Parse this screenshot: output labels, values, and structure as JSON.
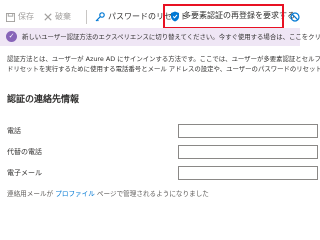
{
  "toolbar": {
    "save_label": "保存",
    "discard_label": "破棄",
    "password_reset_label": "パスワードのリセット",
    "require_mfa_reregister_label": "多要素認証の再登録を要求する"
  },
  "banner": {
    "text": "新しいユーザー認証方法のエクスペリエンスに切り替えてください。今すぐ使用する場合は、ここをクリック"
  },
  "description": {
    "line1": "認証方法とは、ユーザーが Azure AD にサインインする方法です。ここでは、ユーザーが多要素認証とセルフ",
    "line2": "ドリセットを実行するために使用する電話番号とメール アドレスの設定や、ユーザーのパスワードのリセットな"
  },
  "contact": {
    "title": "認証の連絡先情報",
    "phone_label": "電話",
    "phone_value": "",
    "alt_phone_label": "代替の電話",
    "alt_phone_value": "",
    "email_label": "電子メール",
    "email_value": ""
  },
  "note": {
    "prefix": "連絡用メールが ",
    "link": "プロファイル",
    "suffix": " ページで管理されるようになりました"
  }
}
